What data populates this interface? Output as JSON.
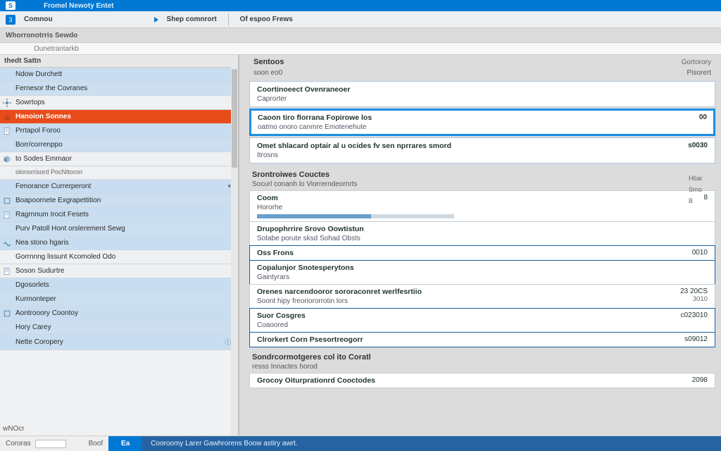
{
  "ribbon": {
    "pill": "S",
    "title": "Fromel Newoty Entet"
  },
  "subbar": {
    "chip": "3",
    "tab1": "Comnou",
    "tab2": "Shep comnrort",
    "tab3": "Of espoo Frews"
  },
  "breadcrumb": "Whorronotrris Sewdo",
  "breadcrumb2": "Ounetrantarkb",
  "sidebar": {
    "header": "thedt Sattn",
    "items": [
      {
        "label": "Ndow Durchett",
        "variant": "alt"
      },
      {
        "label": "Fernesor the Covranes",
        "variant": "alt2"
      },
      {
        "label": "Sowrtops",
        "variant": "plain",
        "icon": "gear"
      },
      {
        "label": "Hanoion Sonnes",
        "variant": "selected",
        "icon": "db"
      },
      {
        "label": "Prrtapol Foroo",
        "variant": "alt",
        "icon": "doc"
      },
      {
        "label": "Borr/correnppo",
        "variant": "alt2"
      },
      {
        "label": "to Sodes Emmaor",
        "variant": "plain",
        "icon": "cube",
        "sub": "olonorrisord PocNttoron"
      },
      {
        "label": "Fenorance Currerperont",
        "variant": "alt",
        "expand": "▾"
      },
      {
        "label": "Boapoornete Exgrapettition",
        "variant": "alt2",
        "icon": "box"
      },
      {
        "label": "Ragrnnum Irocit Fesets",
        "variant": "alt",
        "icon": "doc"
      },
      {
        "label": "Purv Patoll Hont orslerement Sewg",
        "variant": "alt2"
      },
      {
        "label": "Nea stono hgaris",
        "variant": "alt",
        "icon": "wave"
      },
      {
        "label": "Gorrnnng lissunt Kcomoled Odo",
        "variant": "plain",
        "sub": ""
      },
      {
        "label": "Soson Sudurtre",
        "variant": "plain",
        "icon": "doc"
      },
      {
        "label": "Dgosorlets",
        "variant": "alt"
      },
      {
        "label": "Kurmonteper",
        "variant": "alt2"
      },
      {
        "label": "Aontrooory Coontoy",
        "variant": "alt",
        "icon": "box"
      },
      {
        "label": "Hory Carey",
        "variant": "alt2"
      },
      {
        "label": "Nette Coropery",
        "variant": "alt",
        "badge": "ⓘ"
      }
    ],
    "footer1": "wNOcr",
    "footer2": "Cororas",
    "footer3": "Boof"
  },
  "main": {
    "panel1": {
      "title": "Sentoos",
      "right": "Gortorory",
      "sub": "soon eo0",
      "sub_right": "Pisorert"
    },
    "cards": [
      {
        "l1": "Coortinoeect Ovenraneoer",
        "l2": "Caprorter",
        "val": ""
      },
      {
        "l1": "Caoon tiro florrana Fopirowe los",
        "l2": "oatmo onoro canmre Emotenehute",
        "val": "00",
        "sel": true
      },
      {
        "l1": "Omet shlacard optair al u ocides fv sen nprrares smord",
        "l2": "Itrosns",
        "val": "s0030"
      }
    ],
    "section2": {
      "title": "Srontroiwes Couctes",
      "sub": "Socurl conanh lo Viorrerndeornrts"
    },
    "rows": [
      {
        "l1": "Coom",
        "l2": "Hororhe",
        "val": "8",
        "progress": true
      },
      {
        "l1": "Drupophrrire Srovo Oowtistun",
        "l2": "Sotabe porute sksd Sohad Obsts",
        "val": ""
      },
      {
        "l1": "Oss Frons",
        "l2": "",
        "val": "0010",
        "emph": true
      },
      {
        "l1": "Copalunjor Snotesperytons",
        "l2": "Gaintyrars",
        "val": "",
        "emph": true
      },
      {
        "l1": "Orenes narcendooror sororaconret werlfesrtiio",
        "l2": "Soont hipy freoriororrotin lors",
        "val": "23 20CS",
        "val2": "3010"
      },
      {
        "l1": "Suor Cosgres",
        "l2": "Coaoored",
        "val": "c023010",
        "emph": true
      },
      {
        "l1": "Clrorkert Corn Psesortreogorr",
        "l2": "",
        "val": "s09012",
        "emph": true
      }
    ],
    "section3": {
      "title": "Sondrcormotgeres col ito Coratl",
      "sub": "resss Innactes horod"
    },
    "rows2": [
      {
        "l1": "Grocoy Oiturprationrd Cooctodes",
        "val": "2098"
      }
    ],
    "aux": [
      "H6ar",
      "Srno",
      "B"
    ]
  },
  "status": {
    "seg": "Ea",
    "long": "Cooroomy Larer Gawhrorens Boow astiry awrt."
  }
}
